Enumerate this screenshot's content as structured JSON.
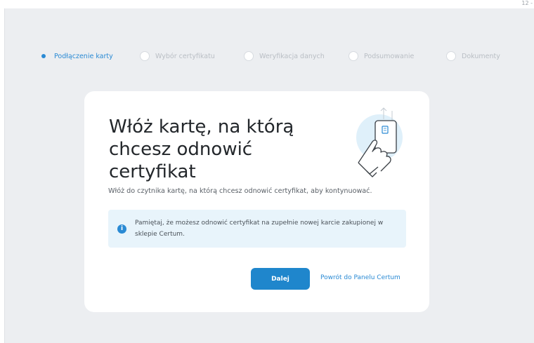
{
  "corner_text": "12 -",
  "stepper": {
    "steps": [
      {
        "label": "Podłączenie karty",
        "state": "active"
      },
      {
        "label": "Wybór certyfikatu",
        "state": "pending"
      },
      {
        "label": "Weryfikacja danych",
        "state": "pending"
      },
      {
        "label": "Podsumowanie",
        "state": "pending"
      },
      {
        "label": "Dokumenty",
        "state": "pending"
      }
    ]
  },
  "card": {
    "title": "Włóż kartę, na którą chcesz odnowić certyfikat",
    "description": "Włóż do czytnika kartę, na którą chcesz odnowić certyfikat, aby kontynuować.",
    "notice": {
      "icon": "info-icon",
      "text": "Pamiętaj, że możesz odnowić certyfikat na zupełnie nowej karcie zakupionej w sklepie Certum."
    },
    "primary_button": "Dalej",
    "secondary_link": "Powrót do Panelu Certum"
  },
  "colors": {
    "accent": "#2a8ad4",
    "button": "#1f86cc",
    "background": "#eceef1",
    "notice_bg": "#e8f4fb"
  }
}
